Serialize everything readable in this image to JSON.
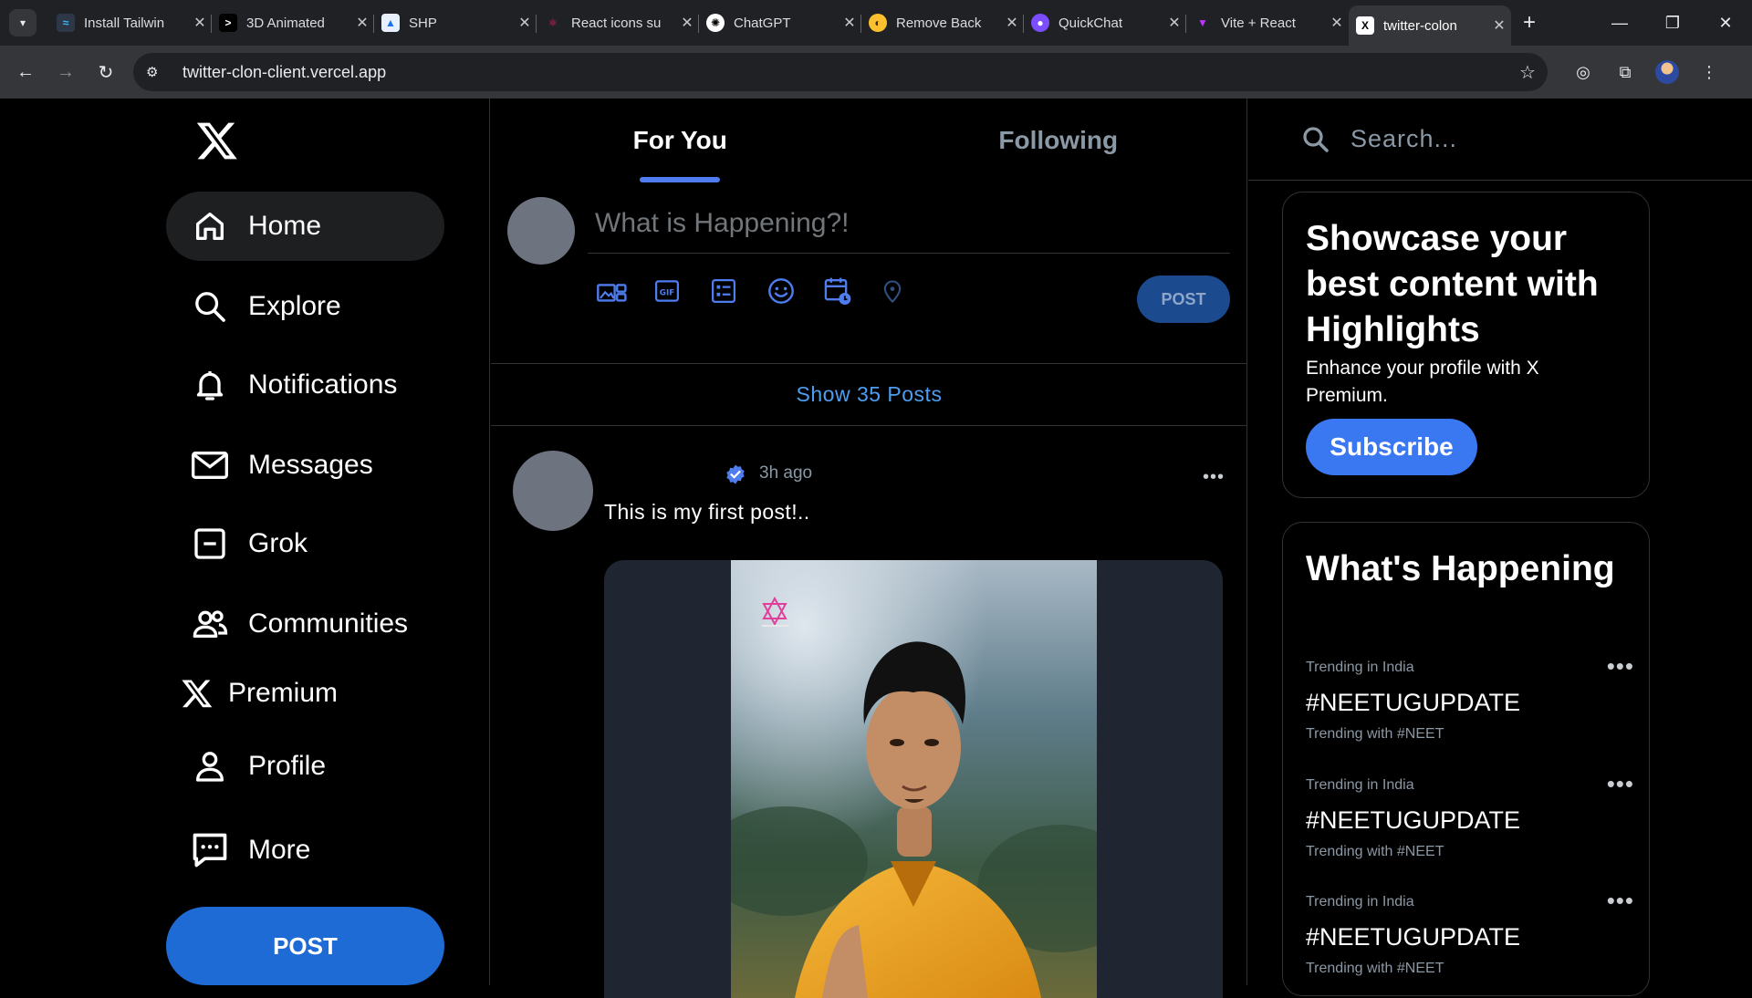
{
  "browser": {
    "tabs": [
      {
        "title": "Install Tailwin",
        "fav_glyph": "≈",
        "fav_bg": "#2d3748",
        "fav_color": "#38bdf8"
      },
      {
        "title": "3D Animated",
        "fav_glyph": ">",
        "fav_bg": "#000000",
        "fav_color": "#ffffff"
      },
      {
        "title": "SHP",
        "fav_glyph": "▲",
        "fav_bg": "#e8f0fe",
        "fav_color": "#1a73e8"
      },
      {
        "title": "React icons su",
        "fav_glyph": "⚛",
        "fav_bg": "#202124",
        "fav_color": "#e91e63"
      },
      {
        "title": "ChatGPT",
        "fav_glyph": "✺",
        "fav_bg": "#ffffff",
        "fav_color": "#000000"
      },
      {
        "title": "Remove Back",
        "fav_glyph": "◐",
        "fav_bg": "#fbc02d",
        "fav_color": "#3e2723"
      },
      {
        "title": "QuickChat",
        "fav_glyph": "●",
        "fav_bg": "#7c4dff",
        "fav_color": "#ffffff"
      },
      {
        "title": "Vite + React",
        "fav_glyph": "▼",
        "fav_bg": "#202124",
        "fav_color": "#bd34fe"
      },
      {
        "title": "twitter-colon",
        "fav_glyph": "X",
        "fav_bg": "#ffffff",
        "fav_color": "#000000",
        "active": true
      }
    ],
    "url": "twitter-clon-client.vercel.app"
  },
  "sidebar": {
    "items": [
      {
        "label": "Home",
        "icon": "home-icon"
      },
      {
        "label": "Explore",
        "icon": "search-icon"
      },
      {
        "label": "Notifications",
        "icon": "bell-icon"
      },
      {
        "label": "Messages",
        "icon": "mail-icon"
      },
      {
        "label": "Grok",
        "icon": "grok-icon"
      },
      {
        "label": "Communities",
        "icon": "people-icon"
      },
      {
        "label": "Premium",
        "icon": "x-logo-icon"
      },
      {
        "label": "Profile",
        "icon": "person-icon"
      },
      {
        "label": "More",
        "icon": "more-chat-icon"
      }
    ],
    "post_label": "POST"
  },
  "feed": {
    "tabs": [
      "For You",
      "Following"
    ],
    "composer": {
      "placeholder": "What is Happening?!",
      "tools": [
        "media-icon",
        "gif-icon",
        "poll-icon",
        "emoji-icon",
        "schedule-icon",
        "location-icon"
      ],
      "post_label": "POST"
    },
    "show_posts": "Show 35 Posts",
    "post": {
      "time": "3h ago",
      "text": "This is my first post!..",
      "more": "•••"
    }
  },
  "right": {
    "search_placeholder": "Search...",
    "premium": {
      "heading": "Showcase your best content with Highlights",
      "subtext": "Enhance your profile with X Premium.",
      "button": "Subscribe"
    },
    "trends": {
      "heading": "What's Happening",
      "items": [
        {
          "context": "Trending in India",
          "title": "#NEETUGUPDATE",
          "sub": "Trending with #NEET"
        },
        {
          "context": "Trending in India",
          "title": "#NEETUGUPDATE",
          "sub": "Trending with #NEET"
        },
        {
          "context": "Trending in India",
          "title": "#NEETUGUPDATE",
          "sub": "Trending with #NEET"
        }
      ],
      "more": "•••"
    }
  },
  "colors": {
    "accent": "#1e6bd6",
    "link": "#4d9ef0",
    "verified": "#4f7df0"
  }
}
